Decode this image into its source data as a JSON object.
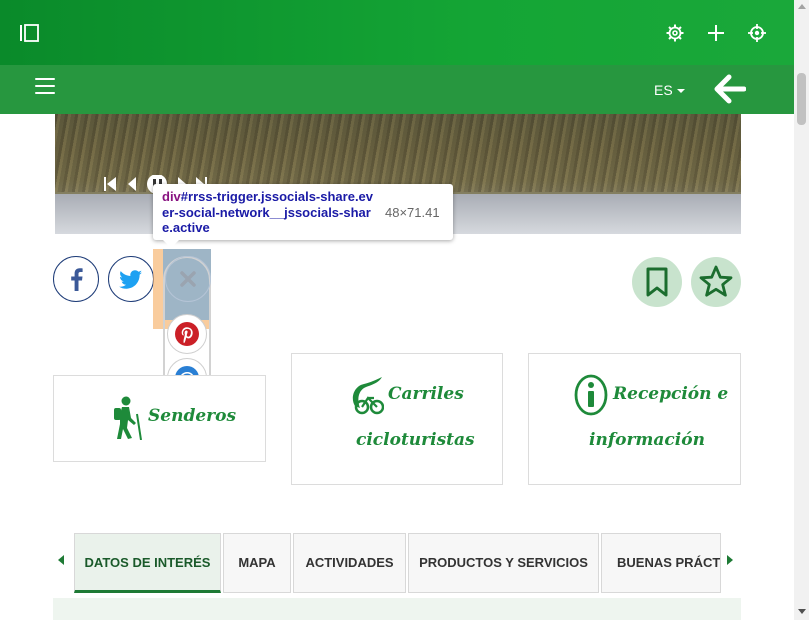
{
  "top_bar": {
    "icons": [
      "sidebar-toggle-icon",
      "gear-icon",
      "plus-icon",
      "crosshair-icon"
    ]
  },
  "nav_bar": {
    "menu_icon": "hamburger-icon",
    "language": "ES",
    "back_icon": "back-arrow-icon"
  },
  "colors": {
    "brand_green": "#1aa83a",
    "nav_green": "#27973f",
    "text_green": "#1e8a3a",
    "facebook_blue": "#3b5998",
    "twitter_blue": "#1da1f2",
    "pinterest_red": "#cb2027",
    "email_blue": "#2a7fd4"
  },
  "devtools_tooltip": {
    "tag": "div",
    "selector": "#rrss-trigger.jssocials-share.ever-social-network__jssocials-share.active",
    "dimensions": "48×71.41"
  },
  "share": {
    "buttons": [
      "facebook-icon",
      "twitter-icon",
      "close-icon",
      "pinterest-icon",
      "email-at-icon"
    ]
  },
  "actions": {
    "icons": [
      "bookmark-icon",
      "star-icon"
    ]
  },
  "cards": [
    {
      "label": "Senderos",
      "icon": "hiker-icon"
    },
    {
      "label_line1": "Carriles",
      "label_line2": "cicloturistas",
      "icon": "bicycle-icon"
    },
    {
      "label_line1": "Recepción e",
      "label_line2": "información",
      "icon": "info-icon"
    }
  ],
  "tabs": [
    {
      "label": "DATOS DE INTERÉS",
      "active": true
    },
    {
      "label": "MAPA",
      "active": false
    },
    {
      "label": "ACTIVIDADES",
      "active": false
    },
    {
      "label": "PRODUCTOS Y SERVICIOS",
      "active": false
    },
    {
      "label": "BUENAS PRÁCTIC",
      "active": false
    }
  ]
}
